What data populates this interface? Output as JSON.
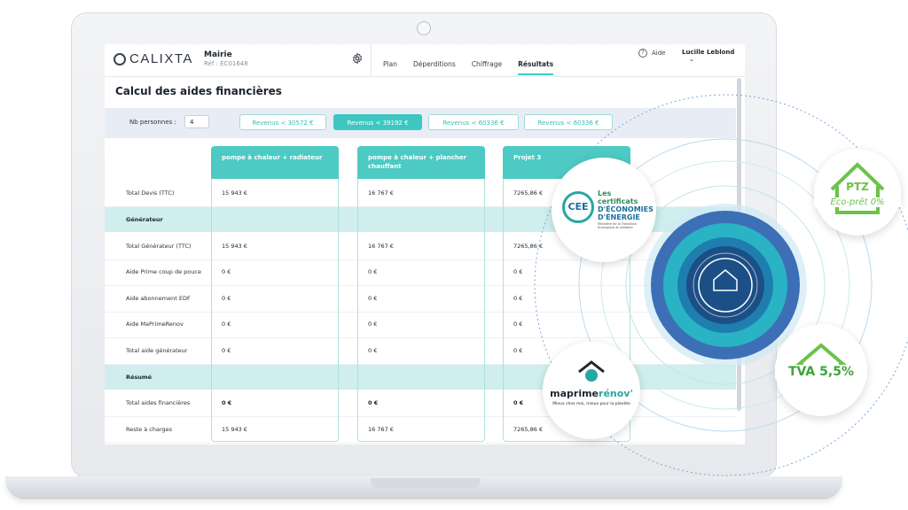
{
  "app": {
    "logo_text": "CALIXTA",
    "project_name": "Mairie",
    "project_ref": "Réf : EC01648"
  },
  "nav": {
    "tabs": [
      {
        "label": "Plan"
      },
      {
        "label": "Déperditions"
      },
      {
        "label": "Chiffrage"
      },
      {
        "label": "Résultats",
        "active": true
      }
    ],
    "help_label": "Aide",
    "user_name": "Lucille Leblond"
  },
  "page": {
    "title": "Calcul des aides financières"
  },
  "filters": {
    "nb_label": "Nb personnes :",
    "nb_value": "4",
    "revenue_buttons": [
      {
        "label": "Revenus < 30572 €",
        "active": false
      },
      {
        "label": "Revenus < 39192 €",
        "active": true
      },
      {
        "label": "Revenus < 60336 €",
        "active": false
      },
      {
        "label": "Revenus < 60336 €",
        "active": false
      }
    ]
  },
  "table": {
    "rows": [
      {
        "label": "Total Devis (TTC)",
        "section": false
      },
      {
        "label": "Générateur",
        "section": true
      },
      {
        "label": "Total Générateur (TTC)",
        "section": false
      },
      {
        "label": "Aide Prime coup de pouce",
        "section": false
      },
      {
        "label": "Aide abonnement EDF",
        "section": false
      },
      {
        "label": "Aide MaPrimeRenov",
        "section": false
      },
      {
        "label": "Total aide générateur",
        "section": false
      },
      {
        "label": "Résumé",
        "section": true
      },
      {
        "label": "Total aides financières",
        "section": false
      },
      {
        "label": "Reste à charges",
        "section": false
      }
    ],
    "columns": [
      {
        "header": "pompe à chaleur + radiateur",
        "values": [
          "15 943 €",
          "",
          "15 943 €",
          "0 €",
          "0 €",
          "0 €",
          "0 €",
          "",
          "0 €",
          "15 943 €"
        ]
      },
      {
        "header": "pompe à chaleur + plancher chauffant",
        "values": [
          "16 767 €",
          "",
          "16 767 €",
          "0 €",
          "0 €",
          "0 €",
          "0 €",
          "",
          "0 €",
          "16 767 €"
        ]
      },
      {
        "header": "Projet 3",
        "values": [
          "7265,86 €",
          "",
          "7265,86 €",
          "0 €",
          "0 €",
          "0 €",
          "0 €",
          "",
          "0 €",
          "7265,86 €"
        ]
      }
    ]
  },
  "badges": {
    "cee_abbr": "CEE",
    "cee_line1": "Les certificats",
    "cee_line2": "D'ÉCONOMIES",
    "cee_line3": "D'ÉNERGIE",
    "cee_small": "Ministère de la Transition écologique et solidaire",
    "ptz_title": "PTZ",
    "ptz_sub": "Éco-prêt 0%",
    "tva_label": "TVA 5,5%",
    "mpr_name_a": "maprime",
    "mpr_name_b": "rénov'",
    "mpr_tagline": "Mieux chez moi, mieux pour la planète"
  },
  "colors": {
    "accent": "#3ec7c1",
    "green_badge": "#6cc24a",
    "blue_ring": "#3d6fb6"
  }
}
